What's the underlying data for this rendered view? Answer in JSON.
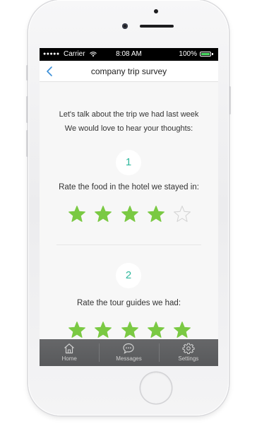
{
  "status_bar": {
    "signal": "●●●●●",
    "carrier": "Carrier",
    "time": "8:08 AM",
    "battery_percent": "100%"
  },
  "nav": {
    "back_icon": "chevron-left-icon",
    "title": "company trip survey"
  },
  "intro": {
    "line1": "Let's talk about the trip we had last week",
    "line2": "We would love to hear your thoughts:"
  },
  "questions": [
    {
      "number": "1",
      "text": "Rate the food in the hotel we stayed in:",
      "rating": 4,
      "max": 5
    },
    {
      "number": "2",
      "text": "Rate the tour guides we had:",
      "rating": 5,
      "max": 5
    }
  ],
  "tabs": [
    {
      "label": "Home",
      "icon": "home-icon"
    },
    {
      "label": "Messages",
      "icon": "chat-bubble-icon"
    },
    {
      "label": "Settings",
      "icon": "gear-icon"
    }
  ],
  "colors": {
    "star_filled": "#7ac943",
    "star_empty": "#d4d4d4",
    "accent": "#2fb89d",
    "back_arrow": "#3a8fd8",
    "tabbar": "#5e5f61"
  }
}
